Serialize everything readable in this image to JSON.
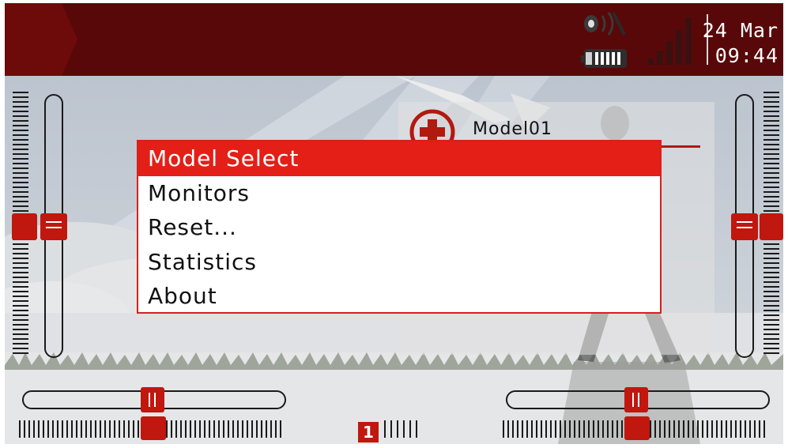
{
  "status_bar": {
    "date": "24 Mar",
    "time": "09:44",
    "icons": [
      "speaker-icon",
      "battery-icon",
      "rssi-signal-icon"
    ]
  },
  "model": {
    "name": "Model01",
    "icon": "model-plus-icon"
  },
  "menu": {
    "items": [
      {
        "label": "Model Select",
        "selected": true
      },
      {
        "label": "Monitors",
        "selected": false
      },
      {
        "label": "Reset...",
        "selected": false
      },
      {
        "label": "Statistics",
        "selected": false
      },
      {
        "label": "About",
        "selected": false
      }
    ]
  },
  "flight_mode": {
    "badge": "1"
  },
  "colors": {
    "topbar": "#590809",
    "accent": "#e31f17",
    "trim": "#c0170f"
  }
}
